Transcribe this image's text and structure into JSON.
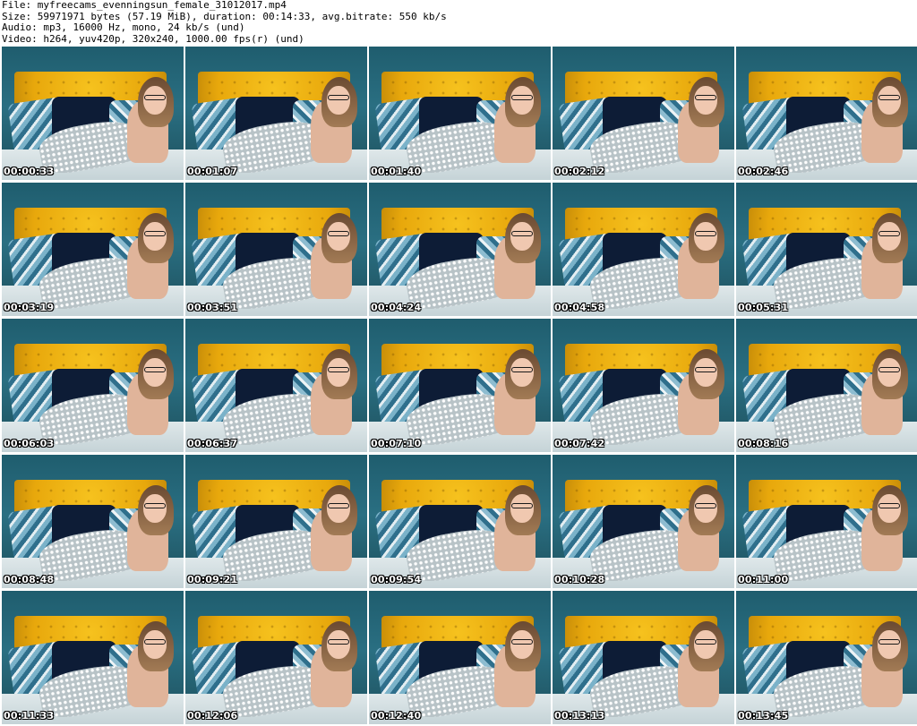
{
  "header": {
    "file_line": "File: myfreecams_evenningsun_female_31012017.mp4",
    "size_line": "Size: 59971971 bytes (57.19 MiB), duration: 00:14:33, avg.bitrate: 550 kb/s",
    "audio_line": "Audio: mp3, 16000 Hz, mono, 24 kb/s (und)",
    "video_line": "Video: h264, yuv420p, 320x240, 1000.00 fps(r) (und)"
  },
  "thumbnails": [
    {
      "timestamp": "00:00:33"
    },
    {
      "timestamp": "00:01:07"
    },
    {
      "timestamp": "00:01:40"
    },
    {
      "timestamp": "00:02:12"
    },
    {
      "timestamp": "00:02:46"
    },
    {
      "timestamp": "00:03:19"
    },
    {
      "timestamp": "00:03:51"
    },
    {
      "timestamp": "00:04:24"
    },
    {
      "timestamp": "00:04:58"
    },
    {
      "timestamp": "00:05:31"
    },
    {
      "timestamp": "00:06:03"
    },
    {
      "timestamp": "00:06:37"
    },
    {
      "timestamp": "00:07:10"
    },
    {
      "timestamp": "00:07:42"
    },
    {
      "timestamp": "00:08:16"
    },
    {
      "timestamp": "00:08:48"
    },
    {
      "timestamp": "00:09:21"
    },
    {
      "timestamp": "00:09:54"
    },
    {
      "timestamp": "00:10:28"
    },
    {
      "timestamp": "00:11:00"
    },
    {
      "timestamp": "00:11:33"
    },
    {
      "timestamp": "00:12:06"
    },
    {
      "timestamp": "00:12:40"
    },
    {
      "timestamp": "00:13:13"
    },
    {
      "timestamp": "00:13:45"
    }
  ],
  "colors": {
    "background": "#ffffff",
    "wall": "#2a6f82",
    "headboard": "#f6c21e",
    "timestamp_text": "#ffffff"
  }
}
